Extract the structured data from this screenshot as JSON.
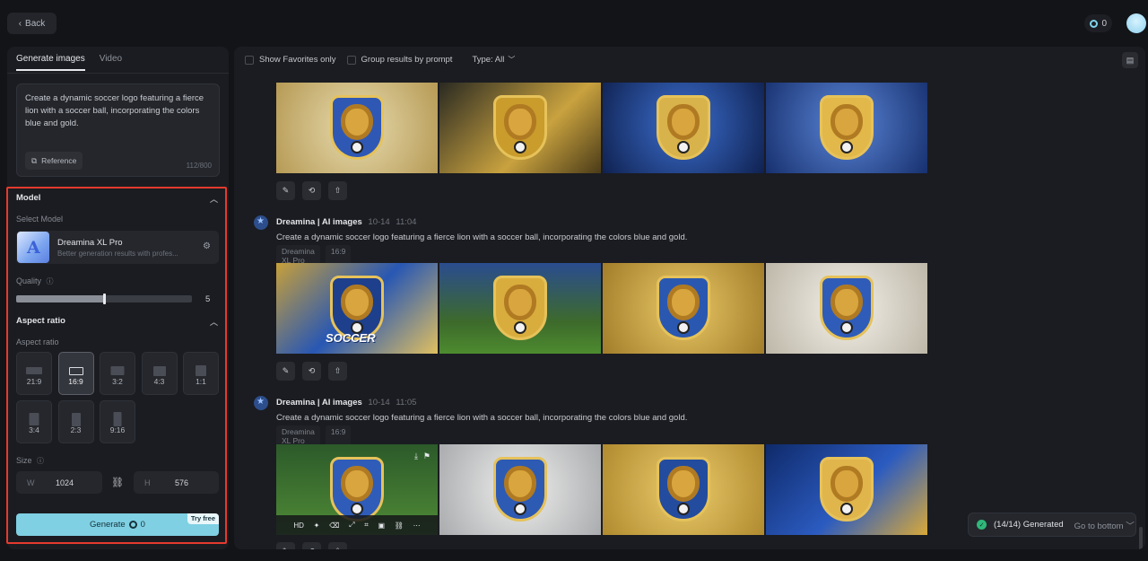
{
  "topbar": {
    "back_label": "Back",
    "credits": "0"
  },
  "left": {
    "tabs": [
      "Generate images",
      "Video"
    ],
    "prompt": "Create a dynamic soccer logo featuring a fierce lion with a soccer ball, incorporating the colors blue and gold.",
    "reference_label": "Reference",
    "char_count": "112/800",
    "model_title": "Model",
    "select_model_label": "Select Model",
    "model_name": "Dreamina XL Pro",
    "model_desc": "Better generation results with profes...",
    "quality_label": "Quality",
    "quality_value": "5",
    "quality_fraction": 0.5,
    "aspect_title": "Aspect ratio",
    "aspect_label": "Aspect ratio",
    "ratios": [
      "21:9",
      "16:9",
      "3:2",
      "4:3",
      "1:1",
      "3:4",
      "2:3",
      "9:16"
    ],
    "selected_ratio": "16:9",
    "size_label": "Size",
    "width_key": "W",
    "width": "1024",
    "height_key": "H",
    "height": "576",
    "generate_label": "Generate",
    "generate_cost": "0",
    "try_free": "Try free"
  },
  "right": {
    "filters": {
      "favorites": "Show Favorites only",
      "group": "Group results by prompt",
      "type": "Type: All"
    },
    "groups": [
      {
        "name": "Dreamina | AI images",
        "date": "10-14",
        "time": "11:04",
        "prompt": "Create a dynamic soccer logo featuring a fierce lion with a soccer ball, incorporating the colors blue and gold.",
        "tags": [
          "Dreamina XL Pro",
          "16:9"
        ]
      },
      {
        "name": "Dreamina | AI images",
        "date": "10-14",
        "time": "11:05",
        "prompt": "Create a dynamic soccer logo featuring a fierce lion with a soccer ball, incorporating the colors blue and gold.",
        "tags": [
          "Dreamina XL Pro",
          "16:9"
        ]
      }
    ],
    "hover_bar": [
      "HD"
    ],
    "toast": {
      "status": "(14/14) Generated",
      "action": "Go to bottom"
    },
    "tile_text": "SOCCER"
  },
  "colors": {
    "accent": "#7fd0e3",
    "highlight": "#e53a2d",
    "gold": "#d9b34a",
    "blue": "#2c5fb8"
  }
}
